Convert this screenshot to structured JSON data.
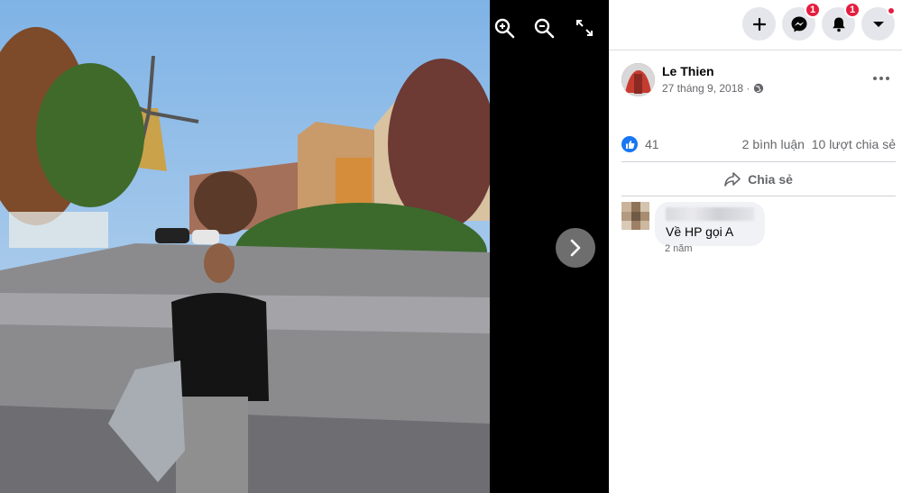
{
  "viewer": {
    "controls": [
      {
        "icon": "zoom-in-icon"
      },
      {
        "icon": "zoom-out-icon"
      },
      {
        "icon": "fullscreen-icon"
      }
    ],
    "next_icon": "chevron-right-icon"
  },
  "topbar": {
    "create_icon": "plus-icon",
    "messenger": {
      "icon": "messenger-icon",
      "badge": "1"
    },
    "notifications": {
      "icon": "bell-icon",
      "badge": "1"
    },
    "account_icon": "caret-down-icon"
  },
  "post": {
    "author": "Le Thien",
    "date": "27 tháng 9, 2018 ·",
    "privacy_icon": "globe-icon",
    "more_icon": "more-horizontal-icon",
    "likes": "41",
    "comments_shares": "2 bình luận  10 lượt chia sẻ",
    "share_label": "Chia sẻ"
  },
  "comment": {
    "text": "Về HP gọi A",
    "time": "2 năm"
  },
  "colors": {
    "accent": "#1877f2",
    "badge": "#e41e3f",
    "panel_bg": "#ffffff",
    "viewer_bg": "#000000"
  }
}
